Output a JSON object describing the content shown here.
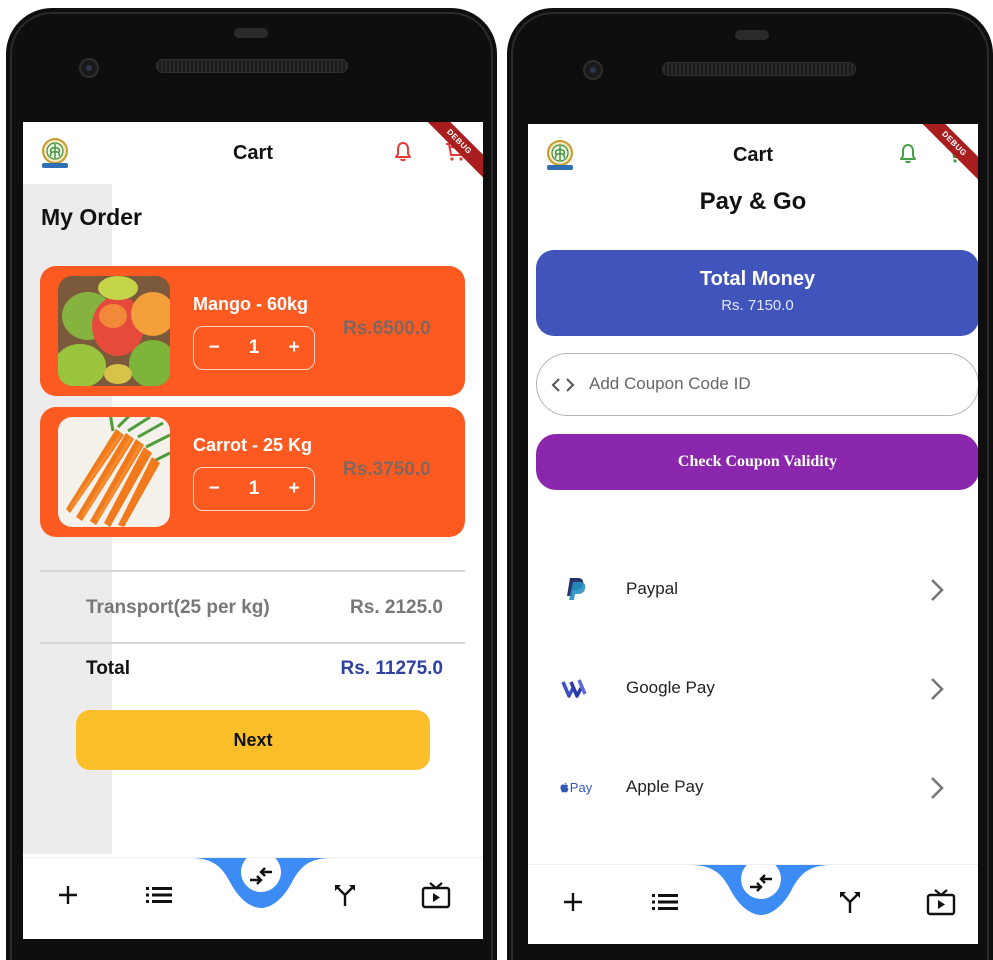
{
  "colors": {
    "orange_card": "#fd5a22",
    "next_yellow": "#fbbf2a",
    "total_blue": "#2e41a3",
    "money_card_blue": "#4054bc",
    "coupon_purple": "#8b27ac",
    "nav_blue": "#3d8bf5",
    "bell_red": "#e53935",
    "bell_green": "#43a047"
  },
  "cart_screen": {
    "title": "Cart",
    "debug": "DEBUG",
    "section_title": "My Order",
    "items": [
      {
        "name": "Mango - 60kg",
        "qty": "1",
        "minus": "−",
        "plus": "+",
        "price": "Rs.6500.0",
        "image_icon": "mango-image"
      },
      {
        "name": "Carrot - 25 Kg",
        "qty": "1",
        "minus": "−",
        "plus": "+",
        "price": "Rs.3750.0",
        "image_icon": "carrot-image"
      }
    ],
    "transport_label": "Transport(25 per kg)",
    "transport_value": "Rs. 2125.0",
    "total_label": "Total",
    "total_value": "Rs. 11275.0",
    "next_label": "Next"
  },
  "pay_screen": {
    "title": "Cart",
    "debug": "DEBUG",
    "heading": "Pay & Go",
    "total_money_label": "Total Money",
    "total_money_value": "Rs. 7150.0",
    "coupon_placeholder": "Add Coupon Code ID",
    "check_coupon_label": "Check Coupon Validity",
    "methods": [
      {
        "label": "Paypal",
        "icon": "paypal-icon"
      },
      {
        "label": "Google Pay",
        "icon": "google-pay-icon"
      },
      {
        "label": "Apple Pay",
        "icon": "apple-pay-icon",
        "icon_text": "Pay"
      }
    ]
  },
  "bottom_nav": {
    "items": [
      "plus-icon",
      "list-icon",
      "swap-icon",
      "merge-icon",
      "tv-play-icon"
    ]
  }
}
